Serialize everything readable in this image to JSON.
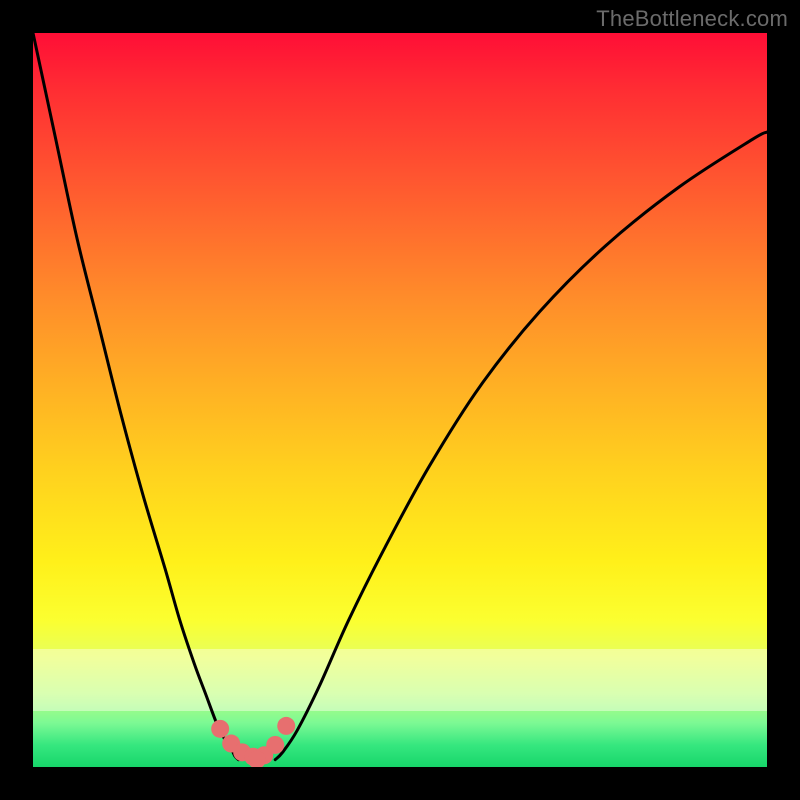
{
  "watermark": "TheBottleneck.com",
  "colors": {
    "frame": "#000000",
    "curve_stroke": "#000000",
    "marker_fill": "#e76f6f",
    "gradient_stops": [
      "#ff0e36",
      "#ff5d2f",
      "#ffb024",
      "#fff01a",
      "#e6ff5c",
      "#36e77f"
    ]
  },
  "chart_data": {
    "type": "line",
    "title": "",
    "xlabel": "",
    "ylabel": "",
    "xlim": [
      0,
      100
    ],
    "ylim": [
      0,
      100
    ],
    "grid": false,
    "legend": false,
    "annotations": [],
    "series": [
      {
        "name": "left-branch",
        "x": [
          0,
          3,
          6,
          9,
          12,
          15,
          18,
          20,
          22,
          23.5,
          25,
          26,
          27,
          27.5,
          28
        ],
        "values": [
          100,
          86,
          72,
          60,
          48,
          37,
          27,
          20,
          14,
          10,
          6,
          4,
          2.5,
          1.5,
          1
        ]
      },
      {
        "name": "right-branch",
        "x": [
          33,
          34,
          36,
          39,
          43,
          48,
          54,
          61,
          69,
          78,
          88,
          98,
          100
        ],
        "values": [
          1,
          2,
          5,
          11,
          20,
          30,
          41,
          52,
          62,
          71,
          79,
          85.5,
          86.5
        ]
      }
    ],
    "markers": {
      "name": "bottom-cluster",
      "x": [
        25.5,
        27,
        28.5,
        30,
        31.5,
        30.5,
        33,
        34.5
      ],
      "values": [
        5.2,
        3.2,
        2.0,
        1.4,
        1.6,
        1.0,
        3.0,
        5.6
      ]
    }
  }
}
